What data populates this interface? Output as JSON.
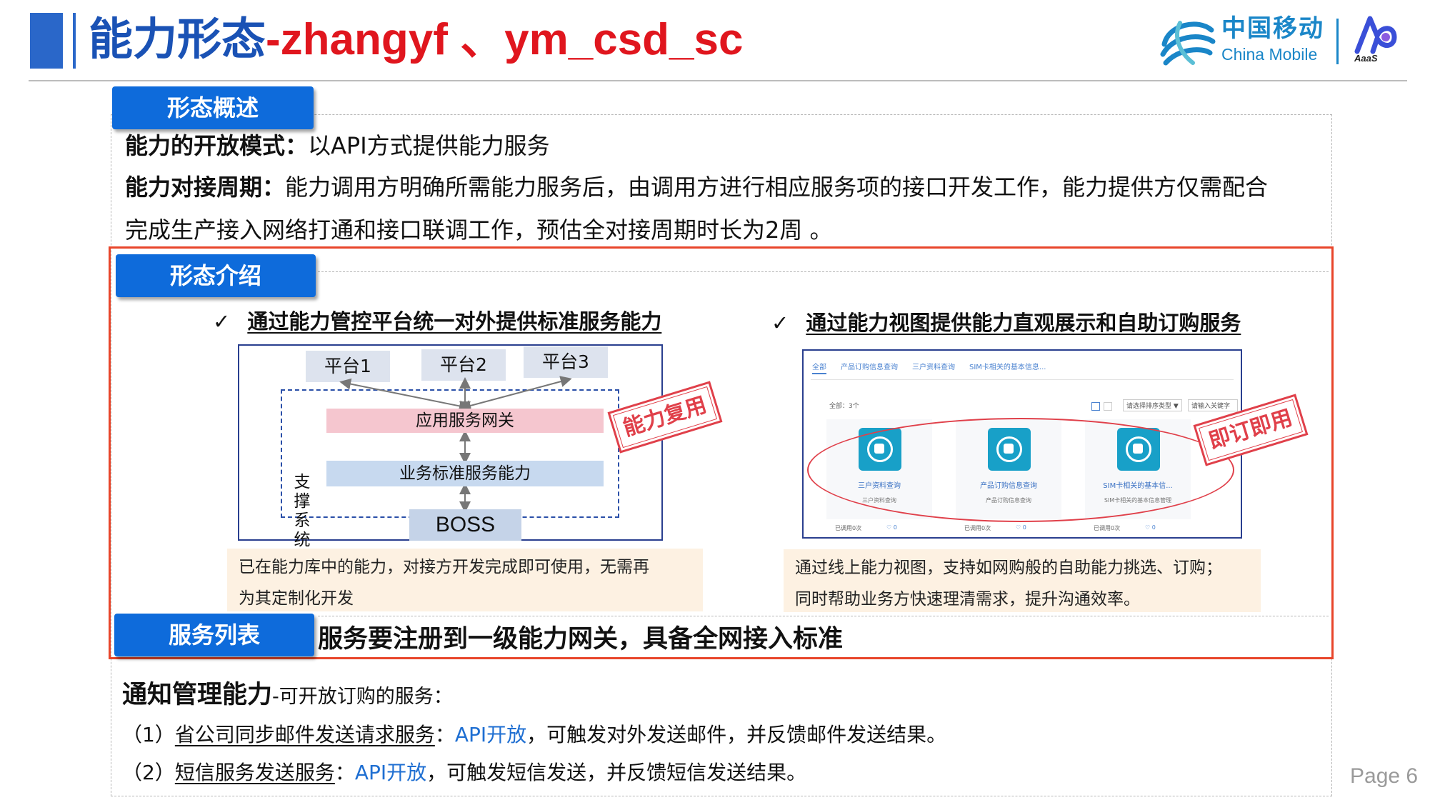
{
  "header": {
    "title_prefix": "能力形态",
    "title_suffix": "-zhangyf 、ym_csd_sc",
    "logo_cn": "中国移动",
    "logo_en": "China Mobile",
    "aaas_label": "AaaS"
  },
  "overview": {
    "tab_label": "形态概述",
    "mode_label": "能力的开放模式：",
    "mode_text": "以API方式提供能力服务",
    "cycle_label": "能力对接周期：",
    "cycle_text_line1": "能力调用方明确所需能力服务后，由调用方进行相应服务项的接口开发工作，能力提供方仅需配合",
    "cycle_text_line2": "完成生产接入网络打通和接口联调工作，预估全对接周期时长为2周 。"
  },
  "intro": {
    "tab_label": "形态介绍",
    "left": {
      "check": "✓",
      "heading": "通过能力管控平台统一对外提供标准服务能力",
      "platforms": [
        "平台1",
        "平台2",
        "平台3"
      ],
      "gateway": "应用服务网关",
      "standard": "业务标准服务能力",
      "boss": "BOSS",
      "support_label": "支撑系统",
      "stamp": "能力复用",
      "note_line1": "已在能力库中的能力，对接方开发完成即可使用，无需再",
      "note_line2": "为其定制化开发"
    },
    "right": {
      "check": "✓",
      "heading": "通过能力视图提供能力直观展示和自助订购服务",
      "stamp": "即订即用",
      "screenshot": {
        "tabs": [
          "全部",
          "产品订购信息查询",
          "三户资料查询",
          "SIM卡相关的基本信息..."
        ],
        "count_label": "全部：3个",
        "sort_select": "请选择排序类型 ▼",
        "search_placeholder": "请输入关键字",
        "cards": [
          {
            "title": "三户资料查询",
            "sub": "三户资料查询",
            "used": "已调用0次",
            "likes": "♡ 0"
          },
          {
            "title": "产品订购信息查询",
            "sub": "产品订购信息查询",
            "used": "已调用0次",
            "likes": "♡ 0"
          },
          {
            "title": "SIM卡相关的基本信...",
            "sub": "SIM卡相关的基本信息管理",
            "used": "已调用0次",
            "likes": "♡ 0"
          }
        ]
      },
      "note_line1": "通过线上能力视图，支持如网购般的自助能力挑选、订购；",
      "note_line2": "同时帮助业务方快速理清需求，提升沟通效率。"
    }
  },
  "services": {
    "tab_label": "服务列表",
    "headline": "服务要注册到一级能力网关，具备全网接入标准",
    "group_title": "通知管理能力",
    "group_suffix": "-可开放订购的服务：",
    "items": [
      {
        "index": "（1）",
        "name": "省公司同步邮件发送请求服务",
        "colon": "：",
        "mode": "API开放",
        "desc": "，可触发对外发送邮件，并反馈邮件发送结果。"
      },
      {
        "index": "（2）",
        "name": "短信服务发送服务",
        "colon": "：",
        "mode": "API开放",
        "desc": "，可触发短信发送，并反馈短信发送结果。"
      }
    ]
  },
  "footer": {
    "page_label": "Page 6"
  },
  "colors": {
    "title_blue": "#1a52b5",
    "title_red": "#e0161e",
    "tab_blue": "#0e6bdb",
    "frame_red": "#e8452a",
    "brand_blue": "#1a86c8"
  }
}
